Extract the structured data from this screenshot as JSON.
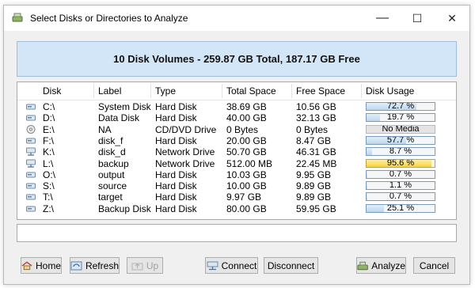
{
  "window": {
    "title": "Select Disks or Directories to Analyze",
    "minimize_glyph": "—",
    "maximize_glyph": "☐",
    "close_glyph": "✕"
  },
  "summary": "10 Disk Volumes - 259.87 GB Total, 187.17 GB Free",
  "columns": {
    "disk": "Disk",
    "label": "Label",
    "type": "Type",
    "total": "Total Space",
    "free": "Free Space",
    "usage": "Disk Usage"
  },
  "disks": [
    {
      "disk": "C:\\",
      "label": "System Disk",
      "type": "Hard Disk",
      "total": "38.69 GB",
      "free": "10.56 GB",
      "usage_text": "72.7 %",
      "usage": 72.7,
      "icon": "hard-disk-icon"
    },
    {
      "disk": "D:\\",
      "label": "Data Disk",
      "type": "Hard Disk",
      "total": "40.00 GB",
      "free": "32.13 GB",
      "usage_text": "19.7 %",
      "usage": 19.7,
      "icon": "hard-disk-icon"
    },
    {
      "disk": "E:\\",
      "label": "NA",
      "type": "CD/DVD Drive",
      "total": "0 Bytes",
      "free": "0 Bytes",
      "usage_text": "No Media",
      "usage": 0,
      "icon": "cd-drive-icon"
    },
    {
      "disk": "F:\\",
      "label": "disk_f",
      "type": "Hard Disk",
      "total": "20.00 GB",
      "free": "8.47 GB",
      "usage_text": "57.7 %",
      "usage": 57.7,
      "icon": "hard-disk-icon"
    },
    {
      "disk": "K:\\",
      "label": "disk_d",
      "type": "Network Drive",
      "total": "50.70 GB",
      "free": "46.31 GB",
      "usage_text": "8.7 %",
      "usage": 8.7,
      "icon": "network-drive-icon"
    },
    {
      "disk": "L:\\",
      "label": "backup",
      "type": "Network Drive",
      "total": "512.00 MB",
      "free": "22.45 MB",
      "usage_text": "95.6 %",
      "usage": 95.6,
      "icon": "network-drive-icon"
    },
    {
      "disk": "O:\\",
      "label": "output",
      "type": "Hard Disk",
      "total": "10.03 GB",
      "free": "9.95 GB",
      "usage_text": "0.7 %",
      "usage": 0.7,
      "icon": "hard-disk-icon"
    },
    {
      "disk": "S:\\",
      "label": "source",
      "type": "Hard Disk",
      "total": "10.00 GB",
      "free": "9.89 GB",
      "usage_text": "1.1 %",
      "usage": 1.1,
      "icon": "hard-disk-icon"
    },
    {
      "disk": "T:\\",
      "label": "target",
      "type": "Hard Disk",
      "total": "9.97 GB",
      "free": "9.89 GB",
      "usage_text": "0.7 %",
      "usage": 0.7,
      "icon": "hard-disk-icon"
    },
    {
      "disk": "Z:\\",
      "label": "Backup Disk",
      "type": "Hard Disk",
      "total": "80.00 GB",
      "free": "59.95 GB",
      "usage_text": "25.1 %",
      "usage": 25.1,
      "icon": "hard-disk-icon"
    }
  ],
  "path_value": "",
  "buttons": {
    "home": "Home",
    "refresh": "Refresh",
    "up": "Up",
    "connect": "Connect",
    "disconnect": "Disconnect",
    "analyze": "Analyze",
    "cancel": "Cancel"
  },
  "colors": {
    "banner": "#d3e6f7",
    "usage_fill": "#bcd6ee",
    "usage_warn": "#f6d243"
  }
}
